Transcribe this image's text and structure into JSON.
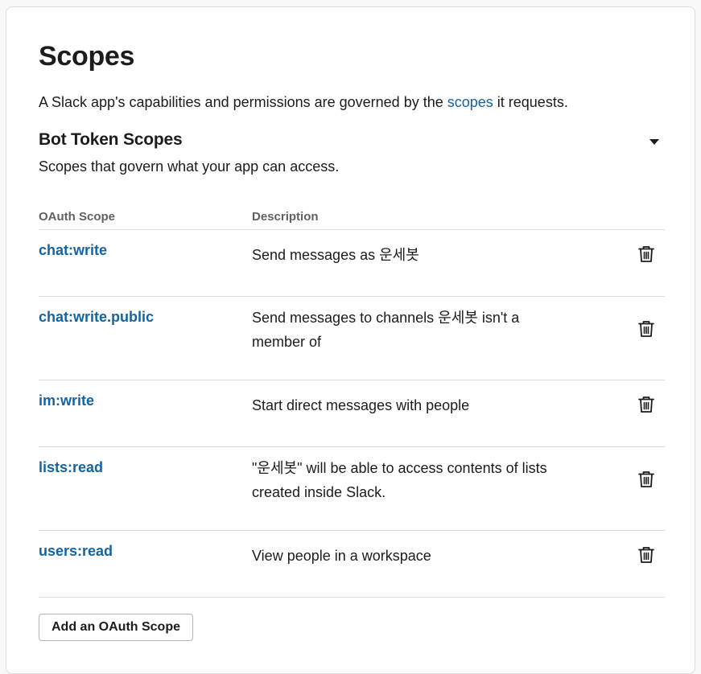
{
  "page": {
    "title": "Scopes",
    "intro_before": "A Slack app's capabilities and permissions are governed by the ",
    "intro_link": "scopes",
    "intro_after": " it requests."
  },
  "section": {
    "title": "Bot Token Scopes",
    "subtitle": "Scopes that govern what your app can access."
  },
  "table": {
    "headers": {
      "scope": "OAuth Scope",
      "description": "Description"
    },
    "rows": [
      {
        "scope": "chat:write",
        "description": "Send messages as 운세봇",
        "delete_icon": "trash-icon"
      },
      {
        "scope": "chat:write.public",
        "description": "Send messages to channels 운세봇 isn't a member of",
        "delete_icon": "trash-icon"
      },
      {
        "scope": "im:write",
        "description": "Start direct messages with people",
        "delete_icon": "trash-icon"
      },
      {
        "scope": "lists:read",
        "description": "\"운세봇\" will be able to access contents of lists created inside Slack.",
        "delete_icon": "trash-icon"
      },
      {
        "scope": "users:read",
        "description": "View people in a workspace",
        "delete_icon": "trash-icon"
      }
    ]
  },
  "actions": {
    "add_scope_label": "Add an OAuth Scope"
  },
  "colors": {
    "link": "#1264a3",
    "text": "#1d1c1d",
    "muted": "#616061",
    "border": "#dddddd"
  }
}
